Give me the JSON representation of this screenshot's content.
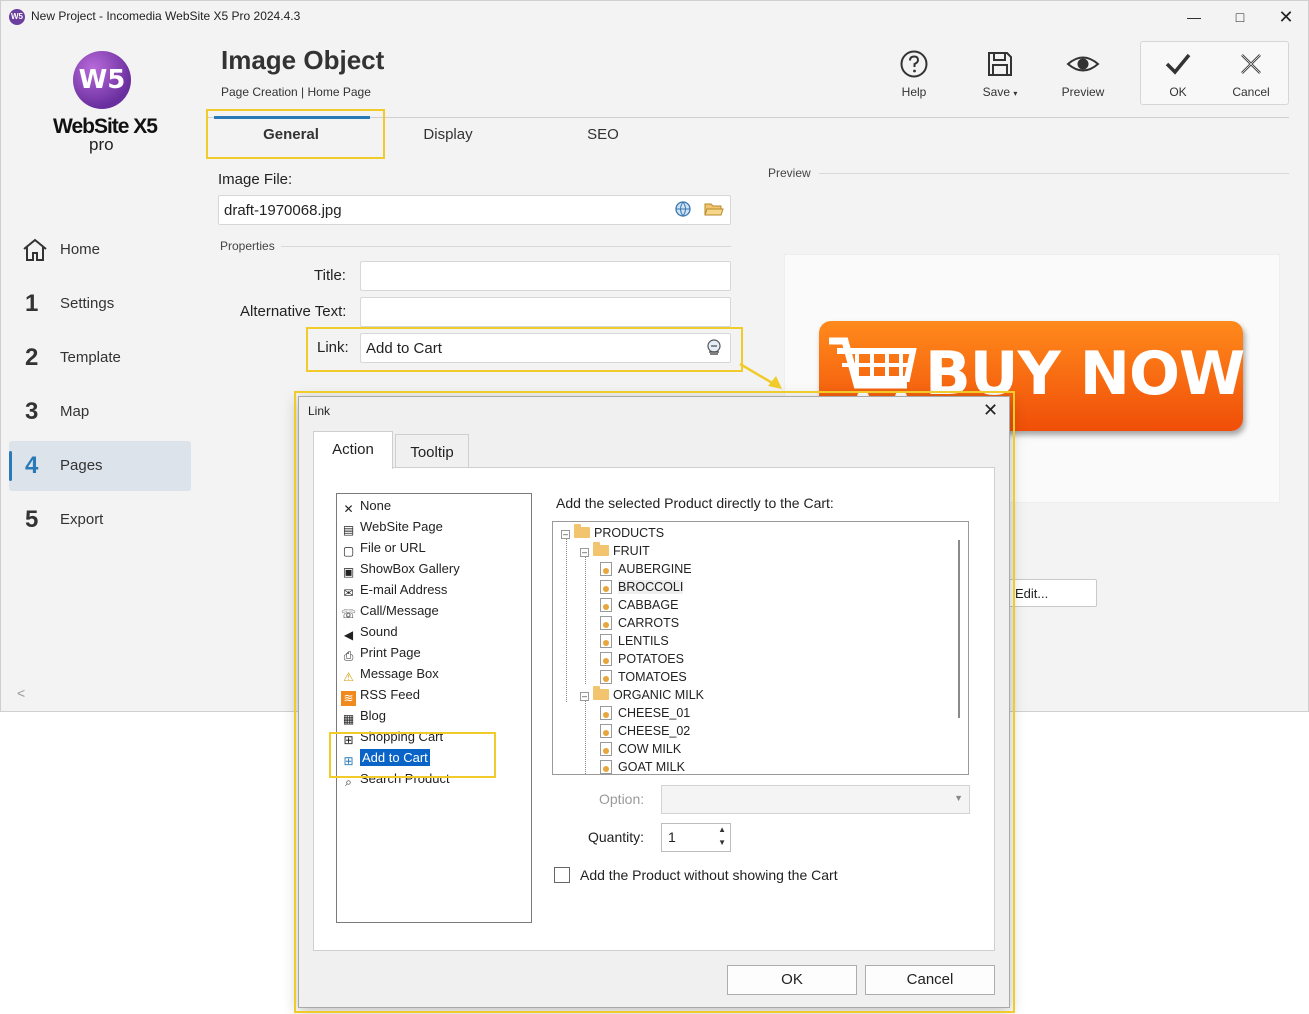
{
  "window": {
    "title": "New Project - Incomedia WebSite X5 Pro 2024.4.3"
  },
  "logo": {
    "mark": "W5",
    "name": "WebSite X5",
    "edition": "pro"
  },
  "sidebar": {
    "items": [
      {
        "num": "",
        "label": "Home"
      },
      {
        "num": "1",
        "label": "Settings"
      },
      {
        "num": "2",
        "label": "Template"
      },
      {
        "num": "3",
        "label": "Map"
      },
      {
        "num": "4",
        "label": "Pages"
      },
      {
        "num": "5",
        "label": "Export"
      }
    ],
    "collapse": "<"
  },
  "header": {
    "title": "Image Object",
    "breadcrumb": "Page Creation | Home Page",
    "tools": {
      "help": "Help",
      "save": "Save",
      "preview": "Preview",
      "ok": "OK",
      "cancel": "Cancel"
    }
  },
  "tabs": [
    "General",
    "Display",
    "SEO"
  ],
  "form": {
    "image_file_label": "Image File:",
    "image_file_value": "draft-1970068.jpg",
    "properties_label": "Properties",
    "title_label": "Title:",
    "title_value": "",
    "alt_label": "Alternative Text:",
    "alt_value": "",
    "link_label": "Link:",
    "link_value": "Add to Cart"
  },
  "preview": {
    "label": "Preview",
    "image_text": "BUY NOW",
    "edit_button": "Edit..."
  },
  "dialog": {
    "title": "Link",
    "tabs": [
      "Action",
      "Tooltip"
    ],
    "actions": [
      {
        "label": "None",
        "icon": "✕"
      },
      {
        "label": "WebSite Page",
        "icon": "▤"
      },
      {
        "label": "File or URL",
        "icon": "▢"
      },
      {
        "label": "ShowBox Gallery",
        "icon": "▣"
      },
      {
        "label": "E-mail Address",
        "icon": "✉"
      },
      {
        "label": "Call/Message",
        "icon": "☏"
      },
      {
        "label": "Sound",
        "icon": "◀"
      },
      {
        "label": "Print Page",
        "icon": "⎙"
      },
      {
        "label": "Message Box",
        "icon": "⚠"
      },
      {
        "label": "RSS Feed",
        "icon": "≋"
      },
      {
        "label": "Blog",
        "icon": "▦"
      },
      {
        "label": "Shopping Cart",
        "icon": "⊞"
      },
      {
        "label": "Add to Cart",
        "icon": "⊞"
      },
      {
        "label": "Search Product",
        "icon": "⌕"
      }
    ],
    "selected_action": "Add to Cart",
    "heading": "Add the selected Product directly to the Cart:",
    "tree": {
      "root": "PRODUCTS",
      "groups": [
        {
          "name": "FRUIT",
          "items": [
            "AUBERGINE",
            "BROCCOLI",
            "CABBAGE",
            "CARROTS",
            "LENTILS",
            "POTATOES",
            "TOMATOES"
          ]
        },
        {
          "name": "ORGANIC MILK",
          "items": [
            "CHEESE_01",
            "CHEESE_02",
            "COW MILK",
            "GOAT MILK"
          ]
        }
      ],
      "selected": "BROCCOLI"
    },
    "option_label": "Option:",
    "option_value": "",
    "quantity_label": "Quantity:",
    "quantity_value": "1",
    "checkbox_label": "Add the Product without showing the Cart",
    "checkbox_checked": false,
    "ok": "OK",
    "cancel": "Cancel"
  },
  "colors": {
    "accent": "#2a7ab8",
    "highlight": "#f1cb2a",
    "selection": "#0a64c8",
    "buy_button": "#f26410"
  }
}
